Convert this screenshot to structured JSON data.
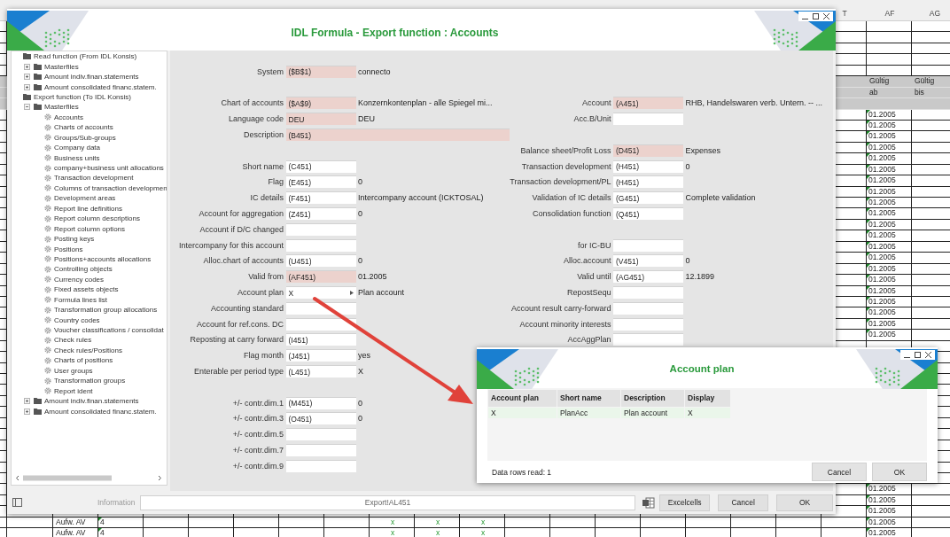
{
  "sheet": {
    "rows": [
      {
        "kind": "letters",
        "t": "T",
        "af": "AF",
        "ag": "AG"
      },
      {
        "kind": "blank"
      },
      {
        "kind": "blank"
      },
      {
        "kind": "blank"
      },
      {
        "kind": "blank"
      },
      {
        "kind": "blank"
      },
      {
        "kind": "label",
        "af": "Gültig",
        "ag": "Gültig"
      },
      {
        "kind": "label",
        "af": "ab",
        "ag": "bis"
      },
      {
        "kind": "band"
      },
      {
        "kind": "date",
        "af": "01.2005"
      },
      {
        "kind": "date",
        "af": "01.2005"
      },
      {
        "kind": "date",
        "af": "01.2005"
      },
      {
        "kind": "date",
        "af": "01.2005"
      },
      {
        "kind": "date",
        "af": "01.2005"
      },
      {
        "kind": "date",
        "af": "01.2005"
      },
      {
        "kind": "date",
        "af": "01.2005"
      },
      {
        "kind": "date",
        "af": "01.2005"
      },
      {
        "kind": "date",
        "af": "01.2005"
      },
      {
        "kind": "date",
        "af": "01.2005"
      },
      {
        "kind": "date",
        "af": "01.2005"
      },
      {
        "kind": "date",
        "af": "01.2005"
      },
      {
        "kind": "date",
        "af": "01.2005"
      },
      {
        "kind": "date",
        "af": "01.2005"
      },
      {
        "kind": "date",
        "af": "01.2005"
      },
      {
        "kind": "date",
        "af": "01.2005"
      },
      {
        "kind": "date",
        "af": "01.2005"
      },
      {
        "kind": "date",
        "af": "01.2005"
      },
      {
        "kind": "date",
        "af": "01.2005"
      },
      {
        "kind": "date",
        "af": "01.2005"
      },
      {
        "kind": "date",
        "af": "01.2005"
      },
      {
        "kind": "blank"
      },
      {
        "kind": "blank"
      },
      {
        "kind": "blank"
      },
      {
        "kind": "blank"
      },
      {
        "kind": "blank"
      },
      {
        "kind": "blank"
      },
      {
        "kind": "blank"
      },
      {
        "kind": "blank"
      },
      {
        "kind": "blank"
      },
      {
        "kind": "blank"
      },
      {
        "kind": "blank"
      },
      {
        "kind": "blank"
      },
      {
        "kind": "blank"
      },
      {
        "kind": "date",
        "af": "01.2005"
      },
      {
        "kind": "date",
        "af": "01.2005"
      },
      {
        "kind": "date",
        "af": "01.2005"
      },
      {
        "kind": "expense",
        "account": "Aufw. AV",
        "number": "4",
        "marks": [
          "x",
          "x",
          "x"
        ],
        "af": "01.2005"
      },
      {
        "kind": "expense",
        "account": "Aufw. AV",
        "number": "4",
        "marks": [
          "x",
          "x",
          "x"
        ],
        "af": "01.2005"
      }
    ]
  },
  "window": {
    "title": "IDL Formula - Export function : Accounts"
  },
  "tree": {
    "items": [
      {
        "kind": "folder",
        "label": "Read function (From IDL Konsis)",
        "children": [
          {
            "kind": "folder",
            "label": "Masterfiles",
            "expanded": false
          },
          {
            "kind": "folder",
            "label": "Amount indiv.finan.statements",
            "expanded": false
          },
          {
            "kind": "folder",
            "label": "Amount consolidated financ.statem.",
            "expanded": false
          }
        ]
      },
      {
        "kind": "folder",
        "label": "Export function (To IDL Konsis)",
        "children": [
          {
            "kind": "folder",
            "label": "Masterfiles",
            "expanded": true,
            "children": [
              {
                "kind": "item",
                "label": "Accounts"
              },
              {
                "kind": "item",
                "label": "Charts of accounts"
              },
              {
                "kind": "item",
                "label": "Groups/Sub-groups"
              },
              {
                "kind": "item",
                "label": "Company data"
              },
              {
                "kind": "item",
                "label": "Business units"
              },
              {
                "kind": "item",
                "label": "company+business unit allocations"
              },
              {
                "kind": "item",
                "label": "Transaction development"
              },
              {
                "kind": "item",
                "label": "Columns of transaction developmen"
              },
              {
                "kind": "item",
                "label": "Development areas"
              },
              {
                "kind": "item",
                "label": "Report line definitions"
              },
              {
                "kind": "item",
                "label": "Report column descriptions"
              },
              {
                "kind": "item",
                "label": "Report column options"
              },
              {
                "kind": "item",
                "label": "Posting keys"
              },
              {
                "kind": "item",
                "label": "Positions"
              },
              {
                "kind": "item",
                "label": "Positions+accounts allocations"
              },
              {
                "kind": "item",
                "label": "Controlling objects"
              },
              {
                "kind": "item",
                "label": "Currency codes"
              },
              {
                "kind": "item",
                "label": "Fixed assets objects"
              },
              {
                "kind": "item",
                "label": "Formula lines list"
              },
              {
                "kind": "item",
                "label": "Transformation group allocations"
              },
              {
                "kind": "item",
                "label": "Country codes"
              },
              {
                "kind": "item",
                "label": "Voucher classifications / consolidat"
              },
              {
                "kind": "item",
                "label": "Check rules"
              },
              {
                "kind": "item",
                "label": "Check rules/Positions"
              },
              {
                "kind": "item",
                "label": "Charts of positions"
              },
              {
                "kind": "item",
                "label": "User groups"
              },
              {
                "kind": "item",
                "label": "Transformation groups"
              },
              {
                "kind": "item",
                "label": "Report ident"
              }
            ]
          },
          {
            "kind": "folder",
            "label": "Amount indiv.finan.statements",
            "expanded": false
          },
          {
            "kind": "folder",
            "label": "Amount consolidated financ.statem.",
            "expanded": false
          }
        ]
      }
    ]
  },
  "form": {
    "rows": [
      {
        "kind": "fields",
        "left": {
          "label": "System",
          "value": "($B$1)",
          "note": "connecto",
          "highlighted": true,
          "kind": "text"
        }
      },
      {
        "kind": "gap"
      },
      {
        "kind": "fields",
        "left": {
          "label": "Chart of accounts",
          "value": "($A$9)",
          "note": "Konzernkontenplan  - alle Spiegel mi...",
          "highlighted": true,
          "kind": "text"
        },
        "right": {
          "label": "Account",
          "value": "(A451)",
          "note": "RHB, Handelswaren verb. Untern. -- ...",
          "highlighted": true,
          "kind": "text"
        }
      },
      {
        "kind": "fields",
        "left": {
          "label": "Language code",
          "value": "DEU",
          "note": "DEU",
          "highlighted": true,
          "kind": "text"
        },
        "right": {
          "label": "Acc.B/Unit",
          "highlighted": false,
          "kind": "text"
        }
      },
      {
        "kind": "fields",
        "left": {
          "label": "Description",
          "value": "(B451)",
          "highlighted": true,
          "kind": "wide"
        }
      },
      {
        "kind": "fields",
        "right": {
          "label": "Balance sheet/Profit  Loss",
          "value": "(D451)",
          "note": "Expenses",
          "highlighted": true,
          "kind": "text"
        }
      },
      {
        "kind": "fields",
        "left": {
          "label": "Short name",
          "value": "(C451)",
          "highlighted": false,
          "kind": "text"
        },
        "right": {
          "label": "Transaction development",
          "value": "(H451)",
          "note": "0",
          "highlighted": false,
          "kind": "text"
        }
      },
      {
        "kind": "fields",
        "left": {
          "label": "Flag",
          "value": "(E451)",
          "note": "0",
          "highlighted": false,
          "kind": "text"
        },
        "right": {
          "label": "Transaction development/PL",
          "value": "(H451)",
          "highlighted": false,
          "kind": "text"
        }
      },
      {
        "kind": "fields",
        "left": {
          "label": "IC details",
          "value": "(F451)",
          "note": "Intercompany account (ICKTOSAL)",
          "highlighted": false,
          "kind": "text"
        },
        "right": {
          "label": "Validation of IC details",
          "value": "(G451)",
          "note": "Complete validation",
          "highlighted": false,
          "kind": "text"
        }
      },
      {
        "kind": "fields",
        "left": {
          "label": "Account for aggregation",
          "value": "(Z451)",
          "note": "0",
          "highlighted": false,
          "kind": "text"
        },
        "right": {
          "label": "Consolidation function",
          "value": "(Q451)",
          "highlighted": false,
          "kind": "text"
        }
      },
      {
        "kind": "fields",
        "left": {
          "label": "Account if D/C changed",
          "highlighted": false,
          "kind": "text"
        }
      },
      {
        "kind": "fields",
        "left": {
          "label": "Intercompany for this account",
          "highlighted": false,
          "kind": "text"
        },
        "right": {
          "label": "for IC-BU",
          "highlighted": false,
          "kind": "text"
        }
      },
      {
        "kind": "fields",
        "left": {
          "label": "Alloc.chart of accounts",
          "value": "(U451)",
          "note": "0",
          "highlighted": false,
          "kind": "text"
        },
        "right": {
          "label": "Alloc.account",
          "value": "(V451)",
          "note": "0",
          "highlighted": false,
          "kind": "text"
        }
      },
      {
        "kind": "fields",
        "left": {
          "label": "Valid from",
          "value": "(AF451)",
          "note": "01.2005",
          "highlighted": true,
          "kind": "text"
        },
        "right": {
          "label": "Valid until",
          "value": "(AG451)",
          "note": "12.1899",
          "highlighted": false,
          "kind": "text"
        }
      },
      {
        "kind": "fields",
        "left": {
          "label": "Account plan",
          "value": "X",
          "note": "Plan account",
          "highlighted": false,
          "kind": "combo"
        },
        "right": {
          "label": "RepostSequ",
          "highlighted": false,
          "kind": "text"
        }
      },
      {
        "kind": "fields",
        "left": {
          "label": "Accounting standard",
          "highlighted": false,
          "kind": "text"
        },
        "right": {
          "label": "Account result carry-forward",
          "highlighted": false,
          "kind": "text"
        }
      },
      {
        "kind": "fields",
        "left": {
          "label": "Account for ref.cons. DC",
          "highlighted": false,
          "kind": "text"
        },
        "right": {
          "label": "Account minority interests",
          "highlighted": false,
          "kind": "text"
        }
      },
      {
        "kind": "fields",
        "left": {
          "label": "Reposting at carry forward",
          "value": "(I451)",
          "highlighted": false,
          "kind": "text"
        },
        "right": {
          "label": "AccAggPlan",
          "highlighted": false,
          "kind": "text"
        }
      },
      {
        "kind": "fields",
        "left": {
          "label": "Flag month",
          "value": "(J451)",
          "note": "yes",
          "highlighted": false,
          "kind": "text"
        }
      },
      {
        "kind": "fields",
        "left": {
          "label": "Enterable per period type",
          "value": "(L451)",
          "note": "X",
          "highlighted": false,
          "kind": "text"
        }
      },
      {
        "kind": "gap"
      },
      {
        "kind": "fields",
        "left": {
          "label": "+/- contr.dim.1",
          "value": "(M451)",
          "note": "0",
          "highlighted": false,
          "kind": "text"
        }
      },
      {
        "kind": "fields",
        "left": {
          "label": "+/- contr.dim.3",
          "value": "(O451)",
          "note": "0",
          "highlighted": false,
          "kind": "text"
        }
      },
      {
        "kind": "fields",
        "left": {
          "label": "+/- contr.dim.5",
          "highlighted": false,
          "kind": "text"
        }
      },
      {
        "kind": "fields",
        "left": {
          "label": "+/- contr.dim.7",
          "highlighted": false,
          "kind": "text"
        }
      },
      {
        "kind": "fields",
        "left": {
          "label": "+/- contr.dim.9",
          "highlighted": false,
          "kind": "text"
        }
      }
    ]
  },
  "bottom_bar": {
    "label": "Information",
    "value": "Export!AL451",
    "buttons": [
      "Excelcells",
      "Cancel",
      "OK"
    ]
  },
  "popup": {
    "title": "Account plan",
    "columns": [
      "Account plan",
      "Short name",
      "Description",
      "Display"
    ],
    "rows": [
      {
        "cells": [
          "X",
          "PlanAcc",
          "Plan account",
          "X"
        ],
        "selected": true
      }
    ],
    "status": "Data rows read: 1",
    "buttons": [
      "Cancel",
      "OK"
    ]
  }
}
